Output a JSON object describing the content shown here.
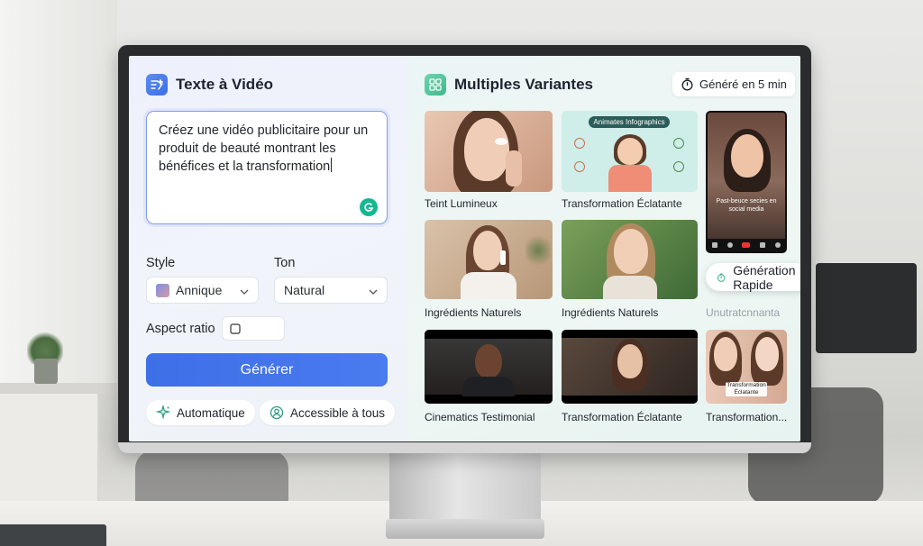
{
  "left_panel": {
    "title": "Texte à Vidéo",
    "prompt": "Créez une vidéo publicitaire pour un produit de beauté montrant les bénéfices et la transformation",
    "style_label": "Style",
    "style_value": "Annique",
    "ton_label": "Ton",
    "ton_value": "Natural",
    "aspect_label": "Aspect ratio",
    "generate_label": "Générer",
    "pill_auto": "Automatique",
    "pill_access": "Accessible à tous"
  },
  "right_panel": {
    "title": "Multiples Variantes",
    "timer": "Généré en 5 min",
    "infographic_title": "Animates Infographics",
    "phone_caption": "Past-beuce secies en social media",
    "cards": [
      {
        "caption": "Teint Lumineux"
      },
      {
        "caption": "Transformation Éclatante"
      },
      {
        "caption": "Ingrédients Naturels"
      },
      {
        "caption": "Ingrédients Naturels"
      },
      {
        "caption": "Unutratcnnanta"
      },
      {
        "caption": "Cinematics Testimonial"
      },
      {
        "caption": "Transformation Éclatante"
      },
      {
        "caption": "Transformation..."
      }
    ],
    "thumb_overlay": "Transformation Éclatante",
    "rapid_label": "Génération Rapide"
  },
  "colors": {
    "accent_blue": "#3e6fe6",
    "accent_green": "#3db98c"
  }
}
